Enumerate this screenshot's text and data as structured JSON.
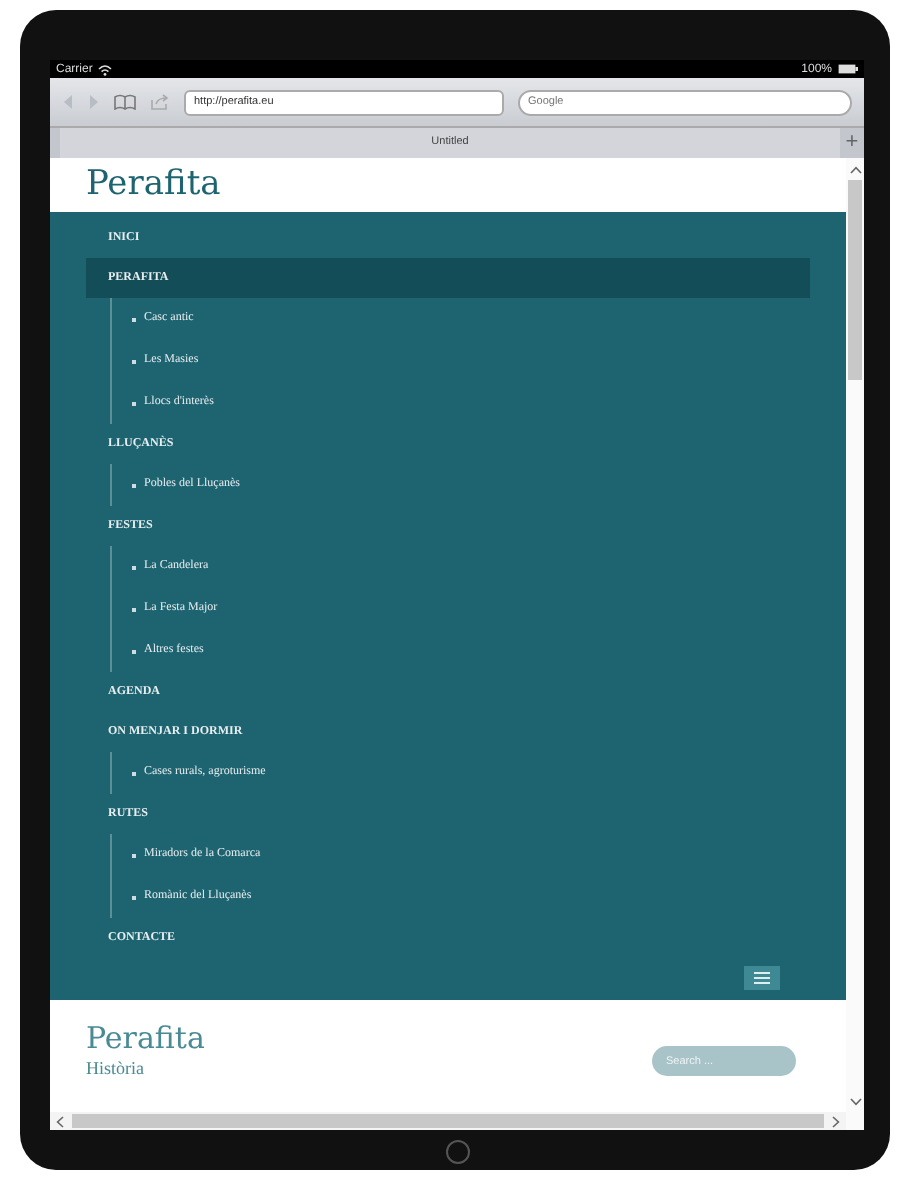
{
  "status_bar": {
    "carrier": "Carrier",
    "battery": "100%"
  },
  "browser": {
    "url": "http://perafita.eu",
    "search_placeholder": "Google",
    "tab_title": "Untitled",
    "new_tab": "+"
  },
  "page": {
    "site_title": "Perafita",
    "menu": [
      {
        "label": "INICI",
        "selected": false
      },
      {
        "label": "PERAFITA",
        "selected": true,
        "children": [
          {
            "label": "Casc antic"
          },
          {
            "label": "Les Masies"
          },
          {
            "label": "Llocs d'interès"
          }
        ]
      },
      {
        "label": "LLUÇANÈS",
        "selected": false,
        "children": [
          {
            "label": "Pobles del Lluçanès"
          }
        ]
      },
      {
        "label": "FESTES",
        "selected": false,
        "children": [
          {
            "label": "La Candelera"
          },
          {
            "label": "La Festa Major"
          },
          {
            "label": "Altres festes"
          }
        ]
      },
      {
        "label": "AGENDA",
        "selected": false
      },
      {
        "label": "ON MENJAR I DORMIR",
        "selected": false,
        "children": [
          {
            "label": "Cases rurals, agroturisme"
          }
        ]
      },
      {
        "label": "RUTES",
        "selected": false,
        "children": [
          {
            "label": "Miradors de la Comarca"
          },
          {
            "label": "Romànic del Lluçanès"
          }
        ]
      },
      {
        "label": "CONTACTE",
        "selected": false
      }
    ],
    "footer_title": "Perafita",
    "search_placeholder": "Search ...",
    "section_heading": "Història"
  }
}
